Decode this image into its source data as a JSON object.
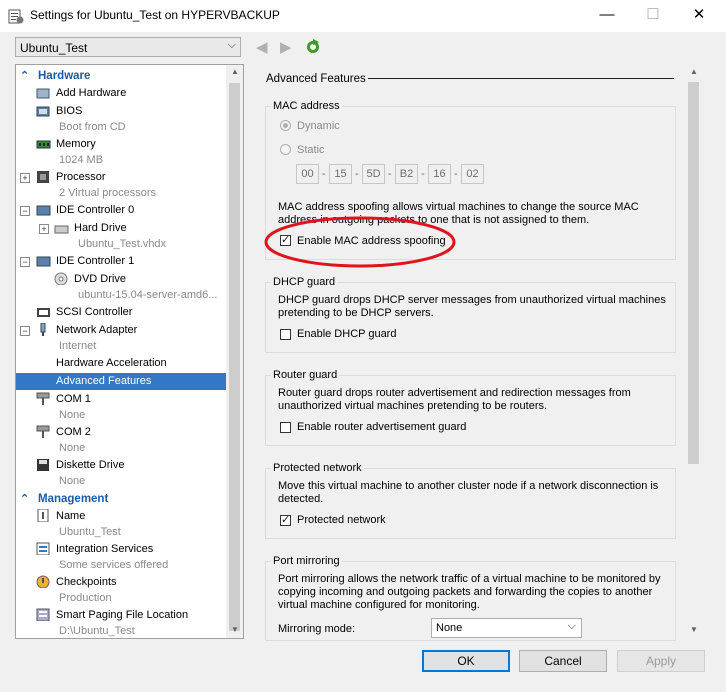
{
  "window": {
    "title": "Settings for Ubuntu_Test on HYPERVBACKUP",
    "minimize": "—",
    "maximize": "☐",
    "close": "✕"
  },
  "vm_selector": {
    "value": "Ubuntu_Test",
    "arrow": "⌵"
  },
  "toolbar": {
    "back": "◀",
    "forward": "▶"
  },
  "tree": {
    "hardware_header": "Hardware",
    "management_header": "Management",
    "items": [
      {
        "name": "Add Hardware",
        "sub": ""
      },
      {
        "name": "BIOS",
        "sub": "Boot from CD"
      },
      {
        "name": "Memory",
        "sub": "1024 MB"
      },
      {
        "name": "Processor",
        "sub": "2 Virtual processors"
      },
      {
        "name": "IDE Controller 0",
        "sub": ""
      },
      {
        "name": "Hard Drive",
        "sub": "Ubuntu_Test.vhdx"
      },
      {
        "name": "IDE Controller 1",
        "sub": ""
      },
      {
        "name": "DVD Drive",
        "sub": "ubuntu-15.04-server-amd6..."
      },
      {
        "name": "SCSI Controller",
        "sub": ""
      },
      {
        "name": "Network Adapter",
        "sub": "Internet"
      },
      {
        "name": "Hardware Acceleration",
        "sub": ""
      },
      {
        "name": "Advanced Features",
        "sub": ""
      },
      {
        "name": "COM 1",
        "sub": "None"
      },
      {
        "name": "COM 2",
        "sub": "None"
      },
      {
        "name": "Diskette Drive",
        "sub": "None"
      }
    ],
    "mgmt_items": [
      {
        "name": "Name",
        "sub": "Ubuntu_Test"
      },
      {
        "name": "Integration Services",
        "sub": "Some services offered"
      },
      {
        "name": "Checkpoints",
        "sub": "Production"
      },
      {
        "name": "Smart Paging File Location",
        "sub": "D:\\Ubuntu_Test"
      }
    ]
  },
  "panel": {
    "title": "Advanced Features",
    "mac": {
      "group_title": "MAC address",
      "dynamic_label": "Dynamic",
      "static_label": "Static",
      "octets": [
        "00",
        "15",
        "5D",
        "B2",
        "16",
        "02"
      ],
      "sep": "-",
      "desc1": "MAC address spoofing allows virtual machines to change the source MAC",
      "desc2": "address in outgoing packets to one that is not assigned to them.",
      "spoof_label": "Enable MAC address spoofing",
      "spoof_checked": true
    },
    "dhcp": {
      "group_title": "DHCP guard",
      "desc1": "DHCP guard drops DHCP server messages from unauthorized virtual machines",
      "desc2": "pretending to be DHCP servers.",
      "label": "Enable DHCP guard",
      "checked": false
    },
    "router": {
      "group_title": "Router guard",
      "desc1": "Router guard drops router advertisement and redirection messages from",
      "desc2": "unauthorized virtual machines pretending to be routers.",
      "label": "Enable router advertisement guard",
      "checked": false
    },
    "protected": {
      "group_title": "Protected network",
      "desc1": "Move this virtual machine to another cluster node if a network disconnection is",
      "desc2": "detected.",
      "label": "Protected network",
      "checked": true
    },
    "mirroring": {
      "group_title": "Port mirroring",
      "desc1": "Port mirroring allows the network traffic of a virtual machine to be monitored by",
      "desc2": "copying incoming and outgoing packets and forwarding the copies to another",
      "desc3": "virtual machine configured for monitoring.",
      "mode_label": "Mirroring mode:",
      "mode_value": "None",
      "arrow": "⌵"
    }
  },
  "buttons": {
    "ok": "OK",
    "cancel": "Cancel",
    "apply": "Apply"
  },
  "colors": {
    "accent": "#3178c6",
    "section": "#1c5aa6",
    "annotation": "#e0141b"
  }
}
